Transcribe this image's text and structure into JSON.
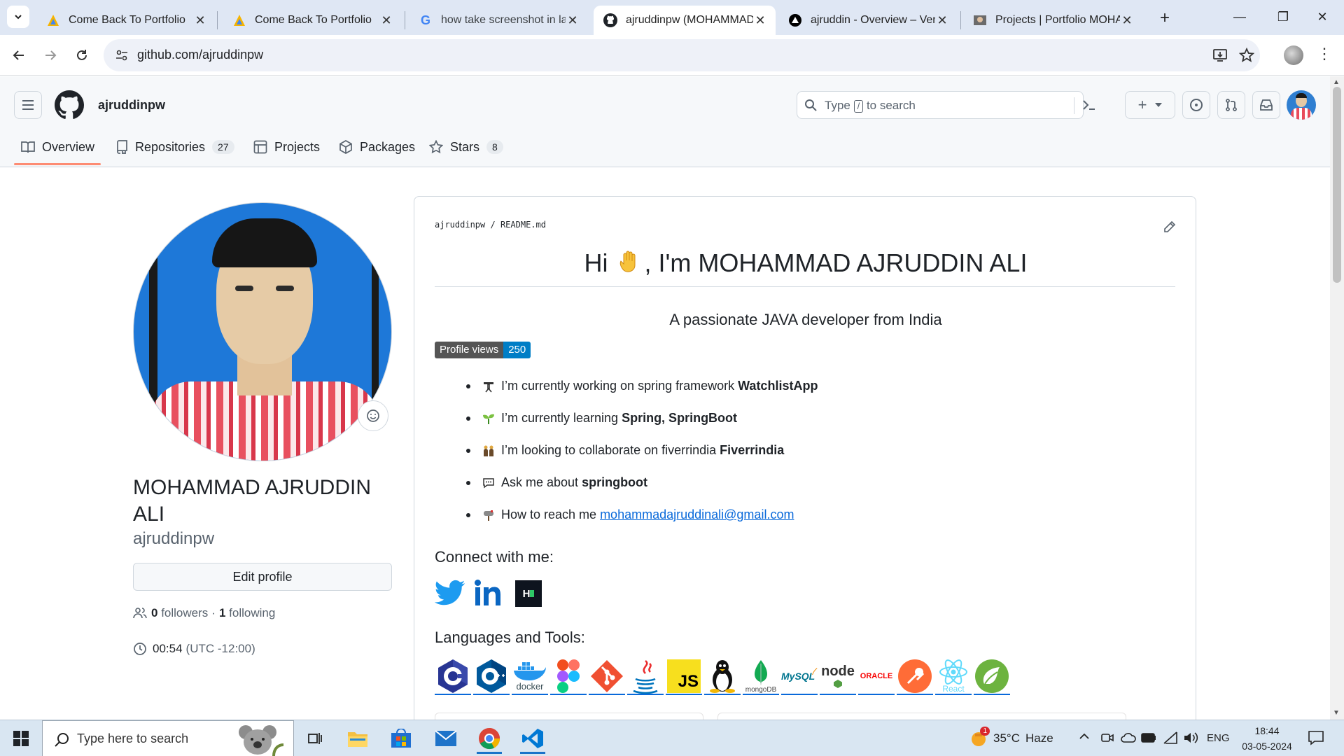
{
  "browser": {
    "tabs": [
      {
        "title": "Come Back To Portfolio",
        "favicon": "vercel-triangle-icon"
      },
      {
        "title": "Come Back To Portfolio",
        "favicon": "vercel-triangle-icon"
      },
      {
        "title": "how take screenshot in lap",
        "favicon": "google-icon"
      },
      {
        "title": "ajruddinpw (MOHAMMAD",
        "favicon": "github-icon"
      },
      {
        "title": "ajruddin - Overview – Verc",
        "favicon": "vercel-icon"
      },
      {
        "title": "Projects | Portfolio MOHAI",
        "favicon": "portfolio-icon"
      }
    ],
    "url": "github.com/ajruddinpw"
  },
  "header": {
    "username": "ajruddinpw",
    "search_placeholder_prefix": "Type",
    "search_key": "/",
    "search_placeholder_suffix": "to search"
  },
  "nav": {
    "overview": "Overview",
    "repositories": "Repositories",
    "repositories_count": "27",
    "projects": "Projects",
    "packages": "Packages",
    "stars": "Stars",
    "stars_count": "8"
  },
  "profile": {
    "name_line1": "MOHAMMAD AJRUDDIN",
    "name_line2": "ALI",
    "login": "ajruddinpw",
    "edit_button": "Edit profile",
    "followers_count": "0",
    "followers_label": "followers",
    "separator": "·",
    "following_count": "1",
    "following_label": "following",
    "local_time": "00:54",
    "timezone": "(UTC -12:00)"
  },
  "readme": {
    "path_owner": "ajruddinpw",
    "path_sep": "/",
    "path_file": "README.md",
    "heading_pre": "Hi",
    "heading_post": ", I'm MOHAMMAD AJRUDDIN ALI",
    "subtitle": "A passionate JAVA developer from India",
    "badge_label": "Profile views",
    "badge_value": "250",
    "items": [
      {
        "emoji": "telescope",
        "text": "I’m currently working on spring framework",
        "bold": "WatchlistApp"
      },
      {
        "emoji": "seedling",
        "text": "I’m currently learning",
        "bold": "Spring, SpringBoot"
      },
      {
        "emoji": "people",
        "text": "I’m looking to collaborate on fiverrindia",
        "bold": "Fiverrindia"
      },
      {
        "emoji": "speech-balloon",
        "text": "Ask me about",
        "bold": "springboot"
      },
      {
        "emoji": "mailbox",
        "text": "How to reach me",
        "link": "mohammadajruddinali@gmail.com"
      }
    ],
    "connect_heading": "Connect with me:",
    "social": [
      "twitter-icon",
      "linkedin-icon",
      "hackerrank-icon"
    ],
    "tools_heading": "Languages and Tools:",
    "tools": [
      {
        "name": "c-icon",
        "label": ""
      },
      {
        "name": "cplusplus-icon",
        "label": ""
      },
      {
        "name": "docker-icon",
        "label": "docker"
      },
      {
        "name": "figma-icon",
        "label": ""
      },
      {
        "name": "git-icon",
        "label": ""
      },
      {
        "name": "java-icon",
        "label": ""
      },
      {
        "name": "javascript-icon",
        "label": "JS"
      },
      {
        "name": "linux-icon",
        "label": ""
      },
      {
        "name": "mongodb-icon",
        "label": "mongoDB"
      },
      {
        "name": "mysql-icon",
        "label": "MySQL"
      },
      {
        "name": "nodejs-icon",
        "label": "node"
      },
      {
        "name": "oracle-icon",
        "label": "ORACLE"
      },
      {
        "name": "postman-icon",
        "label": ""
      },
      {
        "name": "react-icon",
        "label": "React"
      },
      {
        "name": "spring-icon",
        "label": ""
      }
    ]
  },
  "taskbar": {
    "search_placeholder": "Type here to search",
    "weather_temp": "35°C",
    "weather_desc": "Haze",
    "weather_badge": "1",
    "language": "ENG",
    "time": "18:44",
    "date": "03-05-2024"
  },
  "colors": {
    "accent_underline": "#fd8c73",
    "link": "#0969da",
    "badge_left": "#555555",
    "badge_right": "#007ec6",
    "taskbar": "#d9e6f2"
  }
}
